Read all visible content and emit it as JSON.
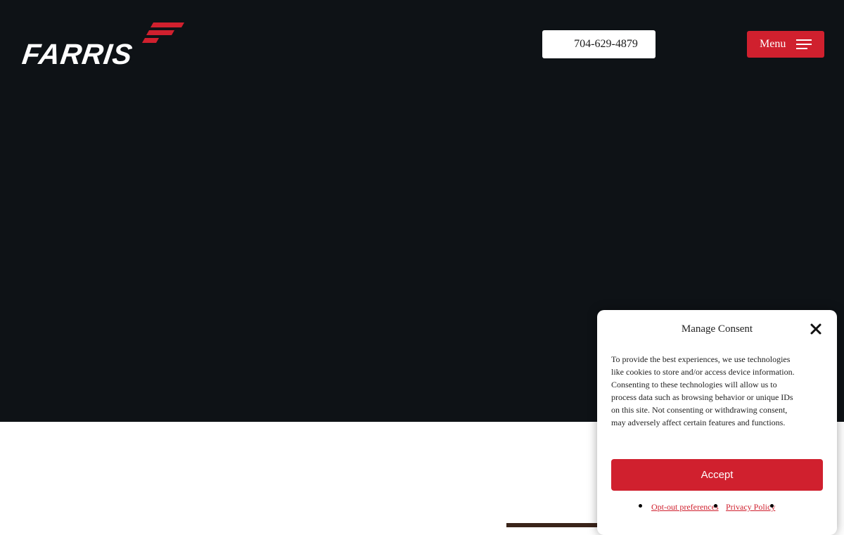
{
  "header": {
    "logo_text": "FARRIS",
    "phone_label": "704-629-4879",
    "menu_label": "Menu"
  },
  "consent": {
    "title": "Manage Consent",
    "body": "To provide the best experiences, we use technologies like cookies to store and/or access device information. Consenting to these technologies will allow us to process data such as browsing behavior or unique IDs on this site. Not consenting or withdrawing consent, may adversely affect certain features and functions.",
    "accept_label": "Accept",
    "links": [
      "Opt-out preferences",
      "Privacy Policy"
    ]
  },
  "colors": {
    "hero_bg": "#0e1216",
    "accent": "#d0202e",
    "page_bg": "#ffffff"
  },
  "icons": [
    "farris-logo-mark-icon",
    "hamburger-menu-icon",
    "close-icon"
  ]
}
